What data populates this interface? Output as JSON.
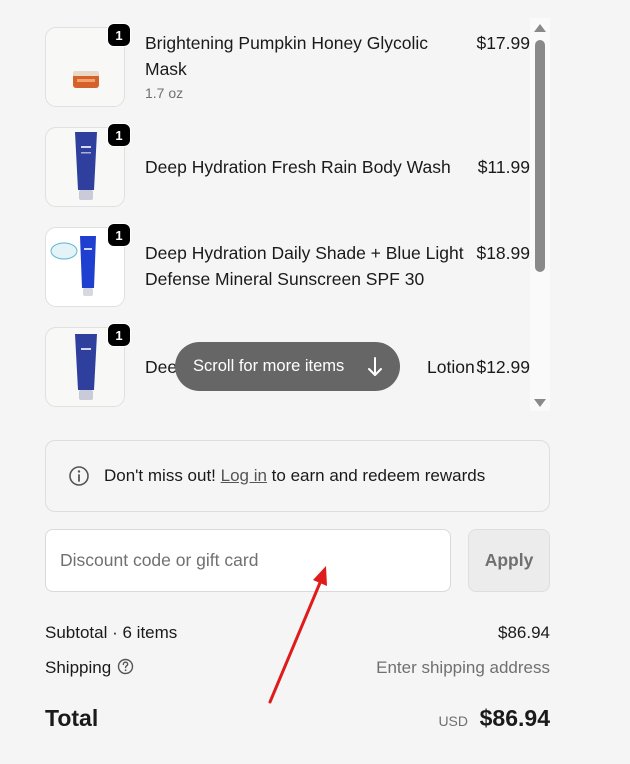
{
  "cart": {
    "items": [
      {
        "name": "Brightening Pumpkin Honey Glycolic Mask",
        "variant": "1.7 oz",
        "price": "$17.99",
        "quantity": "1",
        "image_icon": "pumpkin-mask-jar-icon"
      },
      {
        "name": "Deep Hydration Fresh Rain Body Wash",
        "price": "$11.99",
        "quantity": "1",
        "image_icon": "body-wash-tube-icon"
      },
      {
        "name": "Deep Hydration Daily Shade + Blue Light Defense Mineral Sunscreen SPF 30",
        "price": "$18.99",
        "quantity": "1",
        "image_icon": "sunscreen-tube-icon"
      },
      {
        "name_start": "Dee",
        "name_end": "Lotion",
        "price": "$12.99",
        "quantity": "1",
        "image_icon": "lotion-tube-icon"
      }
    ],
    "scroll_hint": "Scroll for more items"
  },
  "rewards": {
    "before_link": "Don't miss out! ",
    "link": "Log in",
    "after_link": " to earn and redeem rewards"
  },
  "discount": {
    "placeholder": "Discount code or gift card",
    "value": "",
    "apply_label": "Apply"
  },
  "summary": {
    "subtotal_label": "Subtotal · 6 items",
    "subtotal_value": "$86.94",
    "shipping_label": "Shipping",
    "shipping_value": "Enter shipping address",
    "total_label": "Total",
    "currency": "USD",
    "total_value": "$86.94"
  },
  "colors": {
    "background": "#f5f5f5",
    "badge": "#000000",
    "scroll_hint_bg": "#666666",
    "annotation_arrow": "#e01b1b",
    "tube_blue": "#2f3f9e"
  }
}
